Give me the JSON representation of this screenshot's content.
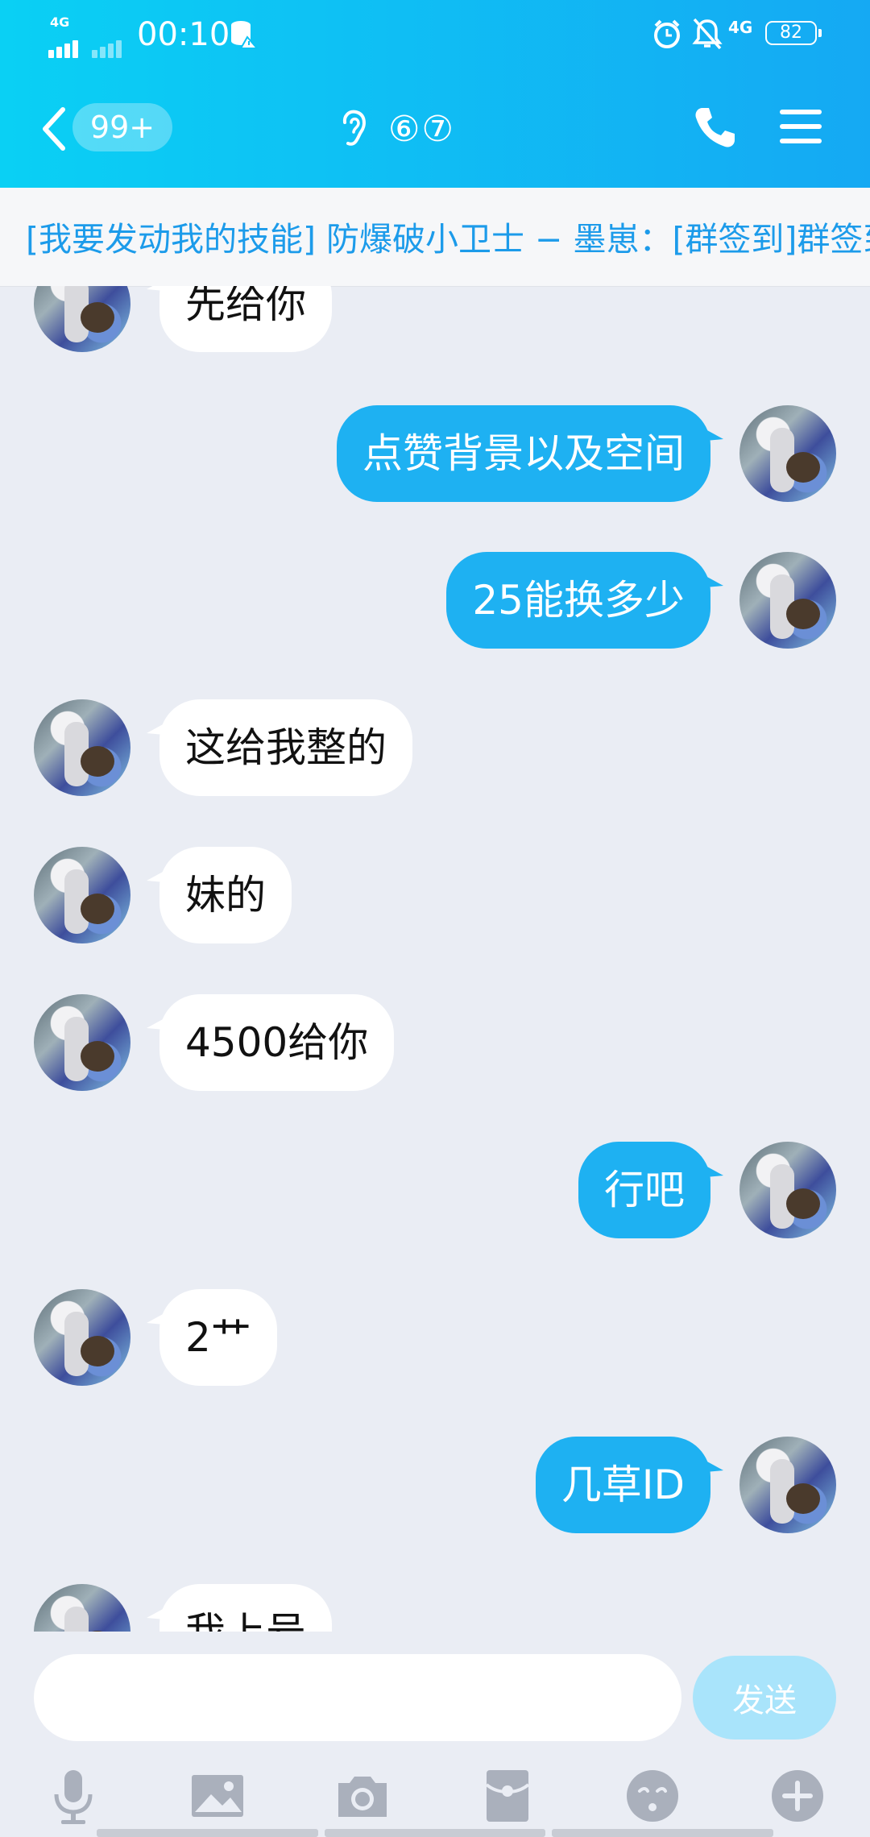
{
  "status_bar": {
    "network_left": "4G",
    "time": "00:10",
    "network_right": "4G",
    "battery": "82"
  },
  "header": {
    "unread_badge": "99+",
    "title": "⑥⑦"
  },
  "notice": {
    "text": "[我要发动我的技能] 防爆破小卫士 − 墨崽：[群签到]群签到"
  },
  "messages": [
    {
      "side": "left",
      "text": "先给你"
    },
    {
      "side": "right",
      "text": "点赞背景以及空间"
    },
    {
      "side": "right",
      "text": "25能换多少"
    },
    {
      "side": "left",
      "text": "这给我整的"
    },
    {
      "side": "left",
      "text": "妹的"
    },
    {
      "side": "left",
      "text": "4500给你"
    },
    {
      "side": "right",
      "text": "行吧"
    },
    {
      "side": "left",
      "text": "2艹"
    },
    {
      "side": "right",
      "text": "几草ID"
    },
    {
      "side": "left",
      "text": "我上号"
    }
  ],
  "input": {
    "value": "",
    "send_label": "发送"
  },
  "toolbar_icons": [
    "mic-icon",
    "image-icon",
    "camera-icon",
    "red-packet-icon",
    "emoji-icon",
    "plus-icon"
  ],
  "colors": {
    "header_start": "#0ad0f4",
    "header_end": "#15a9f3",
    "bubble_out": "#1eb1f2",
    "bubble_in": "#ffffff",
    "notice_text": "#1c9bea",
    "send_disabled": "#a9e4fb"
  }
}
